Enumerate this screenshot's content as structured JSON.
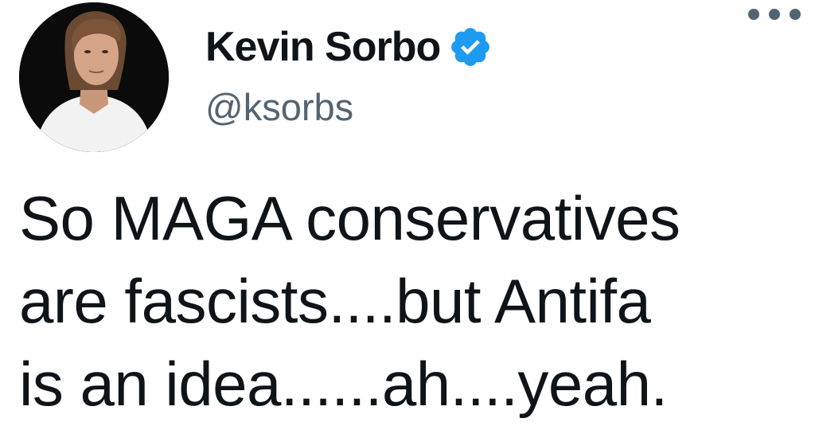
{
  "author": {
    "display_name": "Kevin Sorbo",
    "handle": "@ksorbs",
    "verified": true,
    "avatar_icon": "profile-photo",
    "verified_icon": "verified-badge-icon"
  },
  "menu": {
    "icon": "more-options-icon"
  },
  "tweet": {
    "text": "So MAGA conservatives\nare fascists....but Antifa\nis an idea......ah....yeah."
  },
  "colors": {
    "name": "#0f1419",
    "handle": "#536471",
    "verified_badge": "#1d9bf0",
    "background": "#ffffff"
  }
}
